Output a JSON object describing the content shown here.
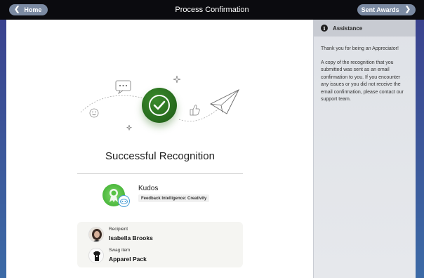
{
  "header": {
    "home_label": "Home",
    "title": "Process Confirmation",
    "sent_label": "Sent Awards"
  },
  "main": {
    "success_title": "Successful Recognition",
    "award": {
      "name": "Kudos",
      "category": "Feedback Intelligence: Creativity"
    },
    "recipient": {
      "label": "Recipient",
      "name": "Isabella Brooks"
    },
    "swag": {
      "label": "Swag item",
      "name": "Apparel Pack"
    }
  },
  "sidebar": {
    "heading": "Assistance",
    "paragraph1": "Thank you for being an Appreciator!",
    "paragraph2": "A copy of the recognition that you submitted was sent as an email confirmation to you. If you encounter any issues or you did not receive the email confirmation, please contact our support team."
  },
  "colors": {
    "accent_green": "#2e7a22",
    "button_gray": "#7b8aa2",
    "topbar": "#0b0b0f"
  }
}
